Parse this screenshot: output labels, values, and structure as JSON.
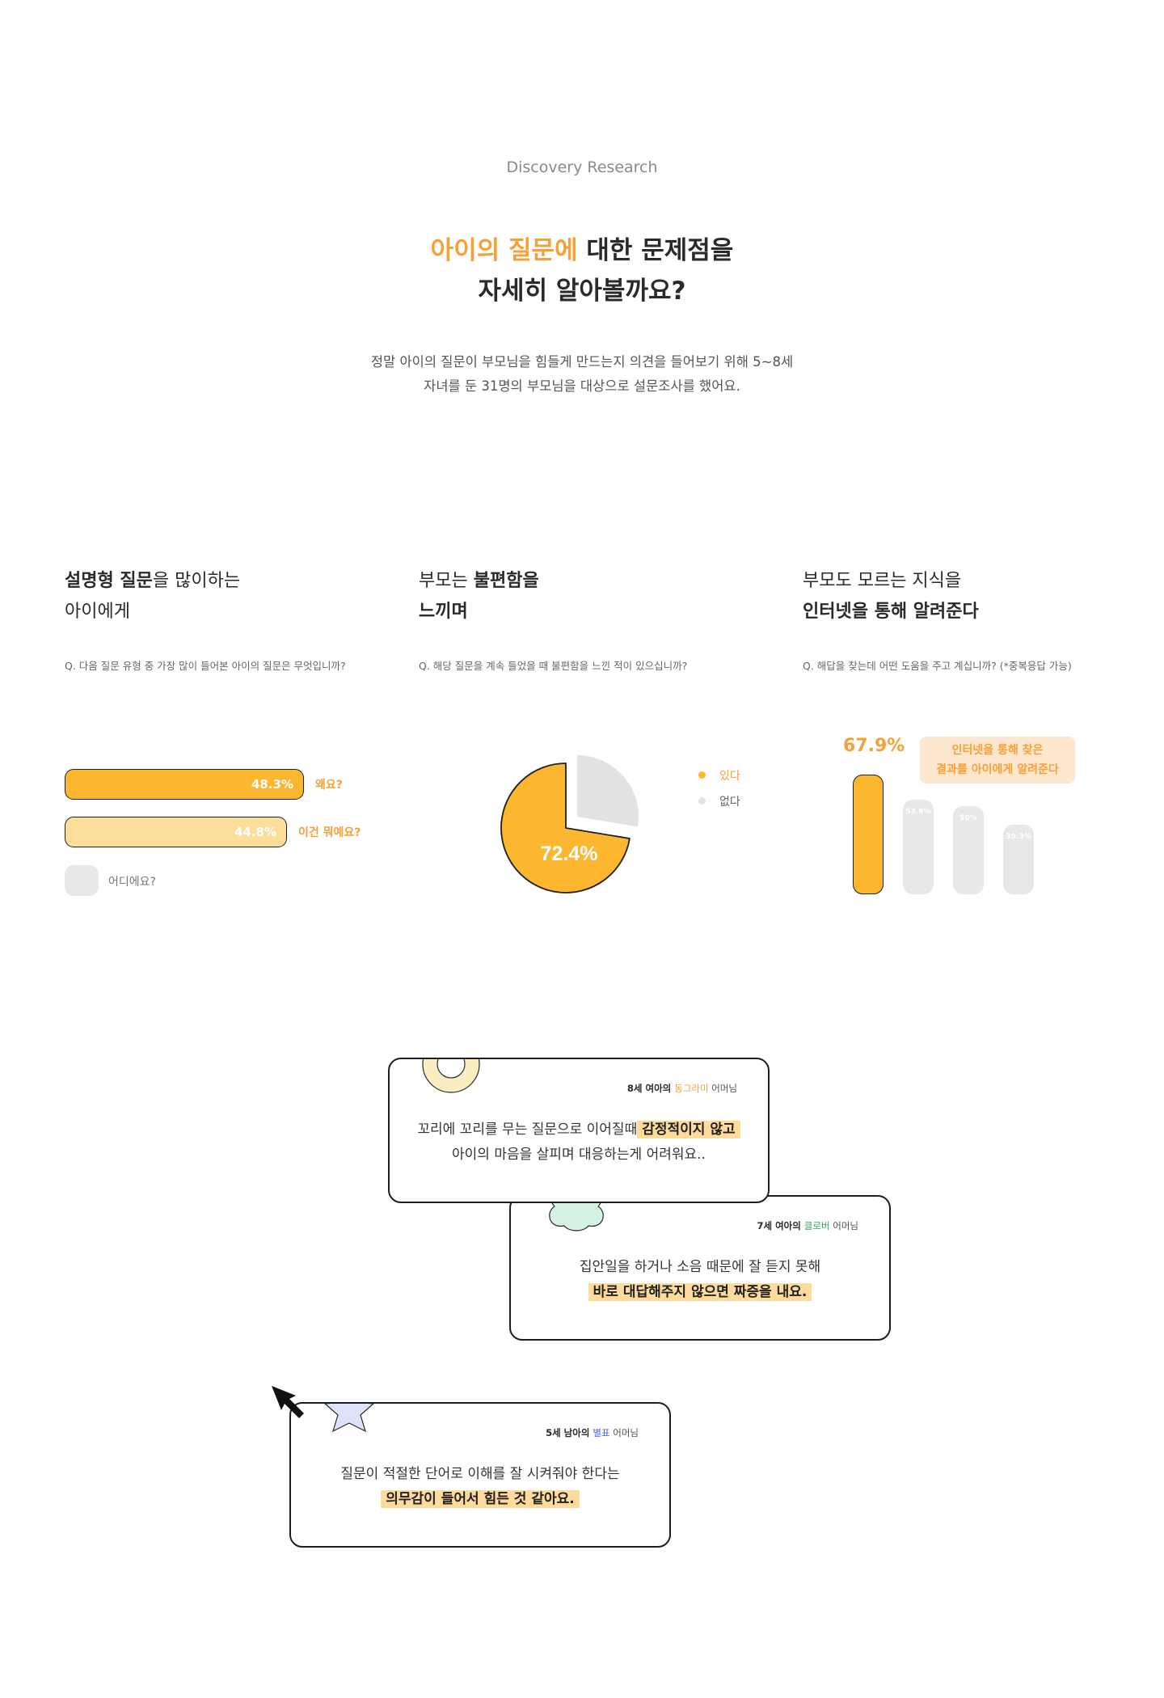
{
  "header": {
    "eyebrow": "Discovery Research",
    "title_accent": "아이의 질문에",
    "title_rest": " 대한 문제점을",
    "title_line2": "자세히 알아볼까요?",
    "intro_line1": "정말 아이의 질문이 부모님을 힘들게 만드는지 의견을 들어보기 위해 5~8세",
    "intro_line2": "자녀를 둔 31명의 부모님을 대상으로 설문조사를 했어요."
  },
  "stats": [
    {
      "heading_bold1": "설명형 질문",
      "heading_rest1": "을 많이하는",
      "heading_line2": "아이에게",
      "question": "Q. 다음 질문 유형 중 가장 많이 들어본 아이의 질문은 무엇입니까?"
    },
    {
      "heading_pre1": "부모는 ",
      "heading_bold1": "불편함을",
      "heading_line2": "느끼며",
      "question": "Q. 해당 질문을 계속 들었을 때 불편함을 느낀 적이 있으십니까?"
    },
    {
      "heading_line1": "부모도 모르는 지식을",
      "heading_line2": "인터넷을 통해 알려준다",
      "question": "Q. 해답을 찾는데 어떤 도움을 주고 계십니까? (*중복응답 가능)"
    }
  ],
  "chart_data": [
    {
      "type": "bar",
      "orientation": "horizontal",
      "categories": [
        "왜요?",
        "이건 뭐예요?",
        "어디에요?"
      ],
      "values": [
        48.3,
        44.8,
        null
      ],
      "value_labels": [
        "48.3%",
        "44.8%",
        ""
      ],
      "colors": [
        "#fdb630",
        "#fddd9a",
        "#e8e8e8"
      ]
    },
    {
      "type": "pie",
      "categories": [
        "있다",
        "없다"
      ],
      "values": [
        72.4,
        27.6
      ],
      "value_label": "72.4%",
      "colors": [
        "#fdb630",
        "#e2e2e2"
      ]
    },
    {
      "type": "bar",
      "orientation": "vertical",
      "values": [
        67.9,
        53.6,
        50,
        39.3
      ],
      "value_labels": [
        "67.9%",
        "53.6%",
        "50%",
        "39.3%"
      ],
      "highlight_text_line1": "인터넷을 통해 찾은",
      "highlight_text_line2": "결과를 아이에게 알려준다",
      "colors": [
        "#fdb630",
        "#e8e8e8"
      ]
    }
  ],
  "quotes": [
    {
      "author_pre": "8세 여아의 ",
      "author_name": "동그라미",
      "author_post": " 어머님",
      "name_color": "#f6a03a",
      "line1_pre": "꼬리에 꼬리를 무는 질문으로 이어질때",
      "line1_hl": "감정적이지 않고",
      "line2": "아이의 마음을 살피며 대응하는게 어려워요.."
    },
    {
      "author_pre": "7세 여아의 ",
      "author_name": "클로버",
      "author_post": " 어머님",
      "name_color": "#3aa46a",
      "line1": "집안일을 하거나 소음 때문에 잘 듣지 못해",
      "line2_hl": "바로 대답해주지 않으면 짜증을 내요."
    },
    {
      "author_pre": "5세 남아의 ",
      "author_name": "별표",
      "author_post": " 어머님",
      "name_color": "#4a62d6",
      "line1": "질문이 적절한 단어로 이해를 잘 시켜줘야 한다는",
      "line2_hl": "의무감이 들어서 힘든 것 같아요."
    }
  ],
  "icons": [
    "circle-shape-icon",
    "clover-shape-icon",
    "star-shape-icon",
    "cursor-arrow-icon"
  ]
}
